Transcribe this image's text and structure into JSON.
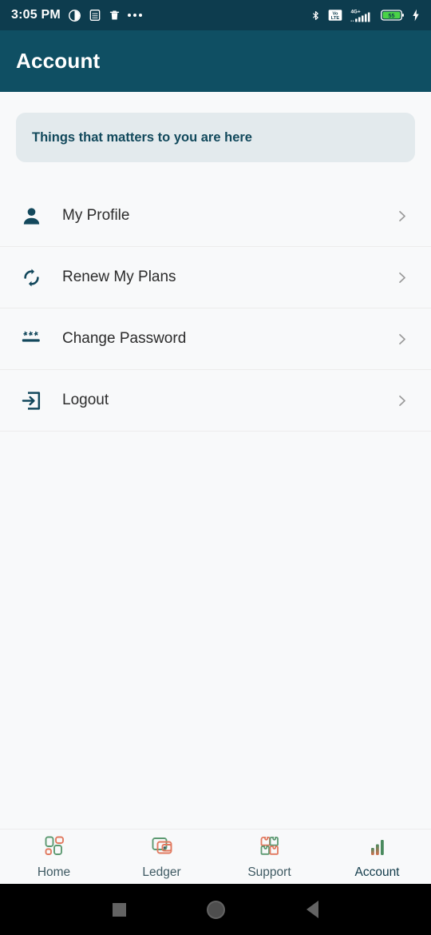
{
  "status_bar": {
    "time": "3:05 PM",
    "left_icons": [
      "brightness-contrast-icon",
      "calculator-icon",
      "trash-icon",
      "overflow-dots-icon"
    ],
    "right_icons": [
      "bluetooth-icon",
      "volte-icon",
      "signal-4gplus-icon",
      "battery-icon",
      "charging-bolt-icon"
    ],
    "network_label": "4G+",
    "volte_label_top": "Vo",
    "volte_label_bottom": "LTE",
    "battery_percent": "55"
  },
  "header": {
    "title": "Account"
  },
  "banner": {
    "text": "Things that matters to you are here"
  },
  "menu": {
    "items": [
      {
        "label": "My Profile",
        "icon": "person-icon",
        "chevron": "chevron-right-icon"
      },
      {
        "label": "Renew My Plans",
        "icon": "refresh-sync-icon",
        "chevron": "chevron-right-icon"
      },
      {
        "label": "Change Password",
        "icon": "password-dots-icon",
        "chevron": "chevron-right-icon"
      },
      {
        "label": "Logout",
        "icon": "logout-arrow-icon",
        "chevron": "chevron-right-icon"
      }
    ]
  },
  "bottom_nav": {
    "items": [
      {
        "label": "Home",
        "icon": "grid-dashboard-icon",
        "active": false
      },
      {
        "label": "Ledger",
        "icon": "wallet-icon",
        "active": false
      },
      {
        "label": "Support",
        "icon": "apps-squares-icon",
        "active": false
      },
      {
        "label": "Account",
        "icon": "bar-chart-icon",
        "active": true
      }
    ]
  },
  "android_nav": {
    "buttons": [
      "recents-square-icon",
      "home-circle-icon",
      "back-triangle-icon"
    ]
  },
  "colors": {
    "status_bar_bg": "#0d3c4e",
    "app_bar_bg": "#0f4f63",
    "body_bg": "#f8f9fa",
    "banner_bg": "#e3eaed",
    "banner_text": "#12495c",
    "icon_teal": "#13485c",
    "chevron_gray": "#9a9a9a",
    "nav_green": "#4a8a5e",
    "nav_salmon": "#e1795f",
    "nav_label": "#3f5a63",
    "battery_green": "#4ad247"
  }
}
